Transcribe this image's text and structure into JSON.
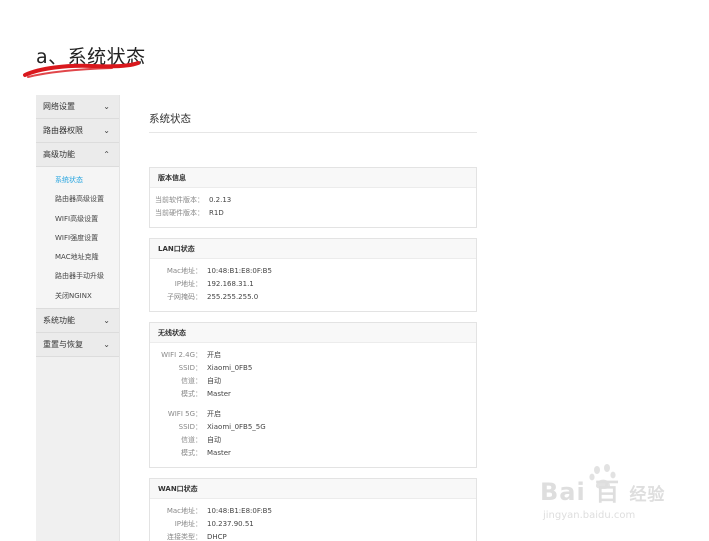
{
  "heading": "a、系统状态",
  "sidebar": {
    "groups": [
      {
        "label": "网络设置",
        "chevron": "chevron-down-icon"
      },
      {
        "label": "路由器权限",
        "chevron": "chevron-down-icon"
      },
      {
        "label": "高级功能",
        "chevron": "chevron-up-icon"
      },
      {
        "label": "系统功能",
        "chevron": "chevron-down-icon"
      },
      {
        "label": "重置与恢复",
        "chevron": "chevron-down-icon"
      }
    ],
    "subitems": [
      {
        "label": "系统状态"
      },
      {
        "label": "路由器高级设置"
      },
      {
        "label": "WIFI高级设置"
      },
      {
        "label": "WIFI强度设置"
      },
      {
        "label": "MAC地址克隆"
      },
      {
        "label": "路由器手动升级"
      },
      {
        "label": "关闭NGINX"
      }
    ]
  },
  "main": {
    "title": "系统状态",
    "version_panel": {
      "header": "版本信息",
      "rows": [
        {
          "k": "当前软件版本：",
          "v": "0.2.13"
        },
        {
          "k": "当前硬件版本：",
          "v": "R1D"
        }
      ]
    },
    "lan_panel": {
      "header": "LAN口状态",
      "rows": [
        {
          "k": "Mac地址：",
          "v": "10:48:B1:E8:0F:B5"
        },
        {
          "k": "IP地址：",
          "v": "192.168.31.1"
        },
        {
          "k": "子网掩码：",
          "v": "255.255.255.0"
        }
      ]
    },
    "wireless_panel": {
      "header": "无线状态",
      "rows_24": [
        {
          "k": "WIFI 2.4G：",
          "v": "开启"
        },
        {
          "k": "SSID：",
          "v": "Xiaomi_0FB5"
        },
        {
          "k": "信道：",
          "v": "自动"
        },
        {
          "k": "模式：",
          "v": "Master"
        }
      ],
      "rows_5": [
        {
          "k": "WIFI 5G：",
          "v": "开启"
        },
        {
          "k": "SSID：",
          "v": "Xiaomi_0FB5_5G"
        },
        {
          "k": "信道：",
          "v": "自动"
        },
        {
          "k": "模式：",
          "v": "Master"
        }
      ]
    },
    "wan_panel": {
      "header": "WAN口状态",
      "rows": [
        {
          "k": "Mac地址：",
          "v": "10:48:B1:E8:0F:B5"
        },
        {
          "k": "IP地址：",
          "v": "10.237.90.51"
        },
        {
          "k": "连接类型：",
          "v": "DHCP"
        }
      ]
    }
  },
  "watermark": {
    "brand": "Bai  百",
    "brand_suffix": "经验",
    "url": "jingyan.baidu.com"
  },
  "colors": {
    "accent": "#29a6e0",
    "underline": "#d9181d",
    "sidebar_bg": "#f0f0f0"
  }
}
